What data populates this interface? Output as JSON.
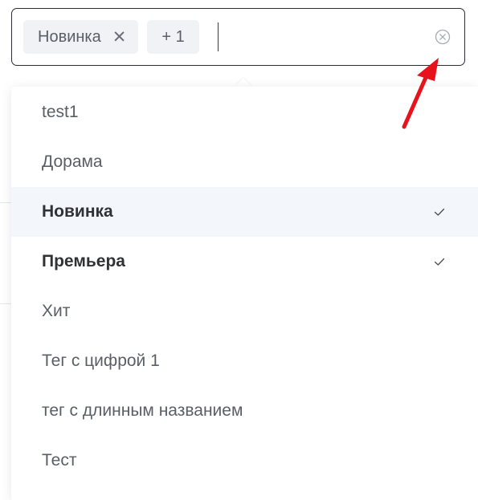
{
  "select": {
    "tags": [
      {
        "label": "Новинка"
      }
    ],
    "more_label": "+ 1",
    "input_value": "",
    "clear_icon": "circle-x-icon"
  },
  "dropdown": {
    "options": [
      {
        "label": "test1",
        "selected": false
      },
      {
        "label": "Дорама",
        "selected": false
      },
      {
        "label": "Новинка",
        "selected": true,
        "hovered": true
      },
      {
        "label": "Премьера",
        "selected": true
      },
      {
        "label": "Хит",
        "selected": false
      },
      {
        "label": "Тег с цифрой 1",
        "selected": false
      },
      {
        "label": "тег с длинным названием",
        "selected": false
      },
      {
        "label": "Тест",
        "selected": false
      }
    ]
  },
  "colors": {
    "border": "#2b2d33",
    "tag_bg": "#f0f2f5",
    "option_text": "#5a5e66",
    "selected_text": "#303236",
    "hover_bg": "#f3f6fa",
    "annotation_arrow": "#e8121c"
  }
}
